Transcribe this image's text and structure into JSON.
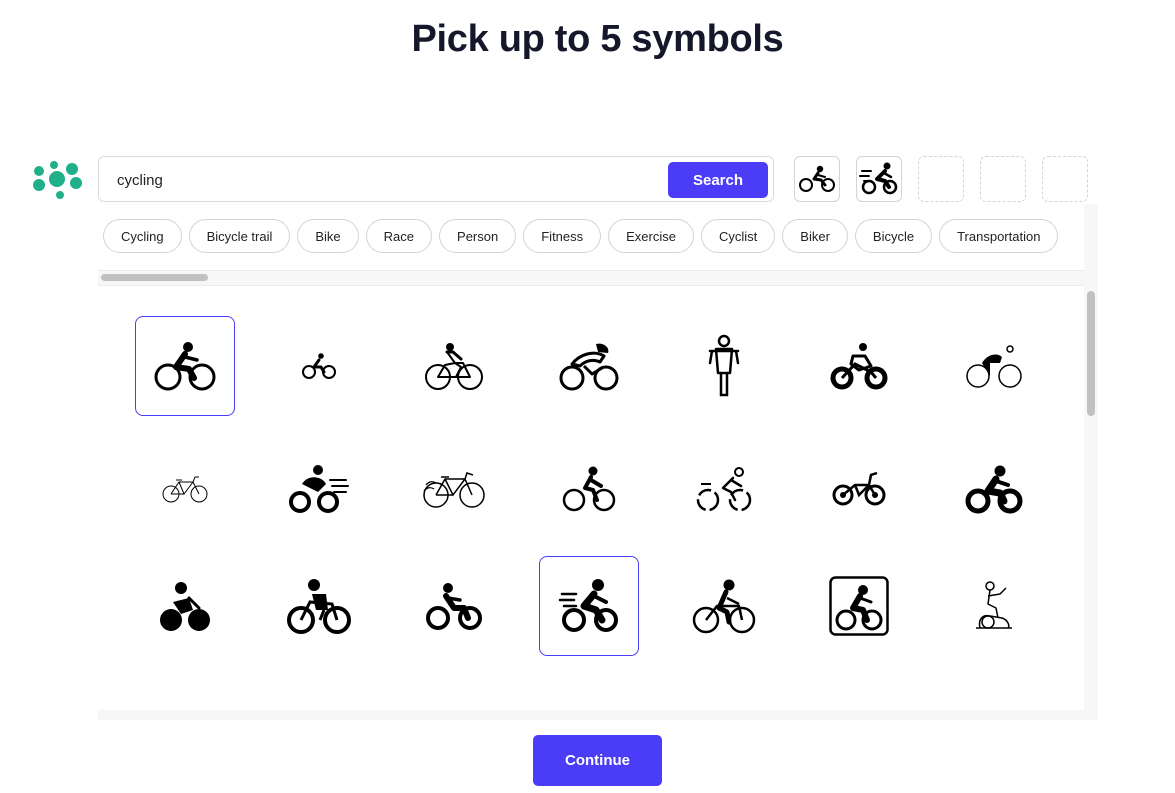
{
  "page": {
    "title": "Pick up to 5 symbols",
    "continue_label": "Continue"
  },
  "search": {
    "value": "cycling",
    "button_label": "Search"
  },
  "selected_slots": [
    {
      "icon": "cyclist-small-icon",
      "filled": true
    },
    {
      "icon": "cyclist-speed-icon",
      "filled": true
    },
    {
      "filled": false
    },
    {
      "filled": false
    },
    {
      "filled": false
    }
  ],
  "suggestions": [
    "Cycling",
    "Bicycle trail",
    "Bike",
    "Race",
    "Person",
    "Fitness",
    "Exercise",
    "Cyclist",
    "Biker",
    "Bicycle",
    "Transportation"
  ],
  "results": [
    {
      "icon": "cyclist-bold-icon",
      "selected": true
    },
    {
      "icon": "cyclist-tiny-icon",
      "selected": false
    },
    {
      "icon": "cyclist-outline-icon",
      "selected": false
    },
    {
      "icon": "racing-cyclist-helmet-icon",
      "selected": false
    },
    {
      "icon": "cyclist-front-view-icon",
      "selected": false
    },
    {
      "icon": "mountain-biker-icon",
      "selected": false
    },
    {
      "icon": "cyclist-thin-icon",
      "selected": false
    },
    {
      "icon": "bicycle-thin-icon",
      "selected": false
    },
    {
      "icon": "cyclist-speed-lines-icon",
      "selected": false
    },
    {
      "icon": "road-bicycle-icon",
      "selected": false
    },
    {
      "icon": "cyclist-simple-icon",
      "selected": false
    },
    {
      "icon": "cyclist-dashed-icon",
      "selected": false
    },
    {
      "icon": "bmx-bicycle-icon",
      "selected": false
    },
    {
      "icon": "cyclist-heavy-icon",
      "selected": false
    },
    {
      "icon": "cyclist-solid-wheels-icon",
      "selected": false
    },
    {
      "icon": "cyclist-bold-alt-icon",
      "selected": false
    },
    {
      "icon": "cyclist-heavy-alt-icon",
      "selected": false
    },
    {
      "icon": "cyclist-motion-icon",
      "selected": true
    },
    {
      "icon": "cyclist-lines-icon",
      "selected": false
    },
    {
      "icon": "cyclist-framed-icon",
      "selected": false
    },
    {
      "icon": "exercise-bike-icon",
      "selected": false
    }
  ],
  "colors": {
    "accent": "#4a3cf7",
    "logo": "#1fb08a",
    "title": "#15172a"
  }
}
